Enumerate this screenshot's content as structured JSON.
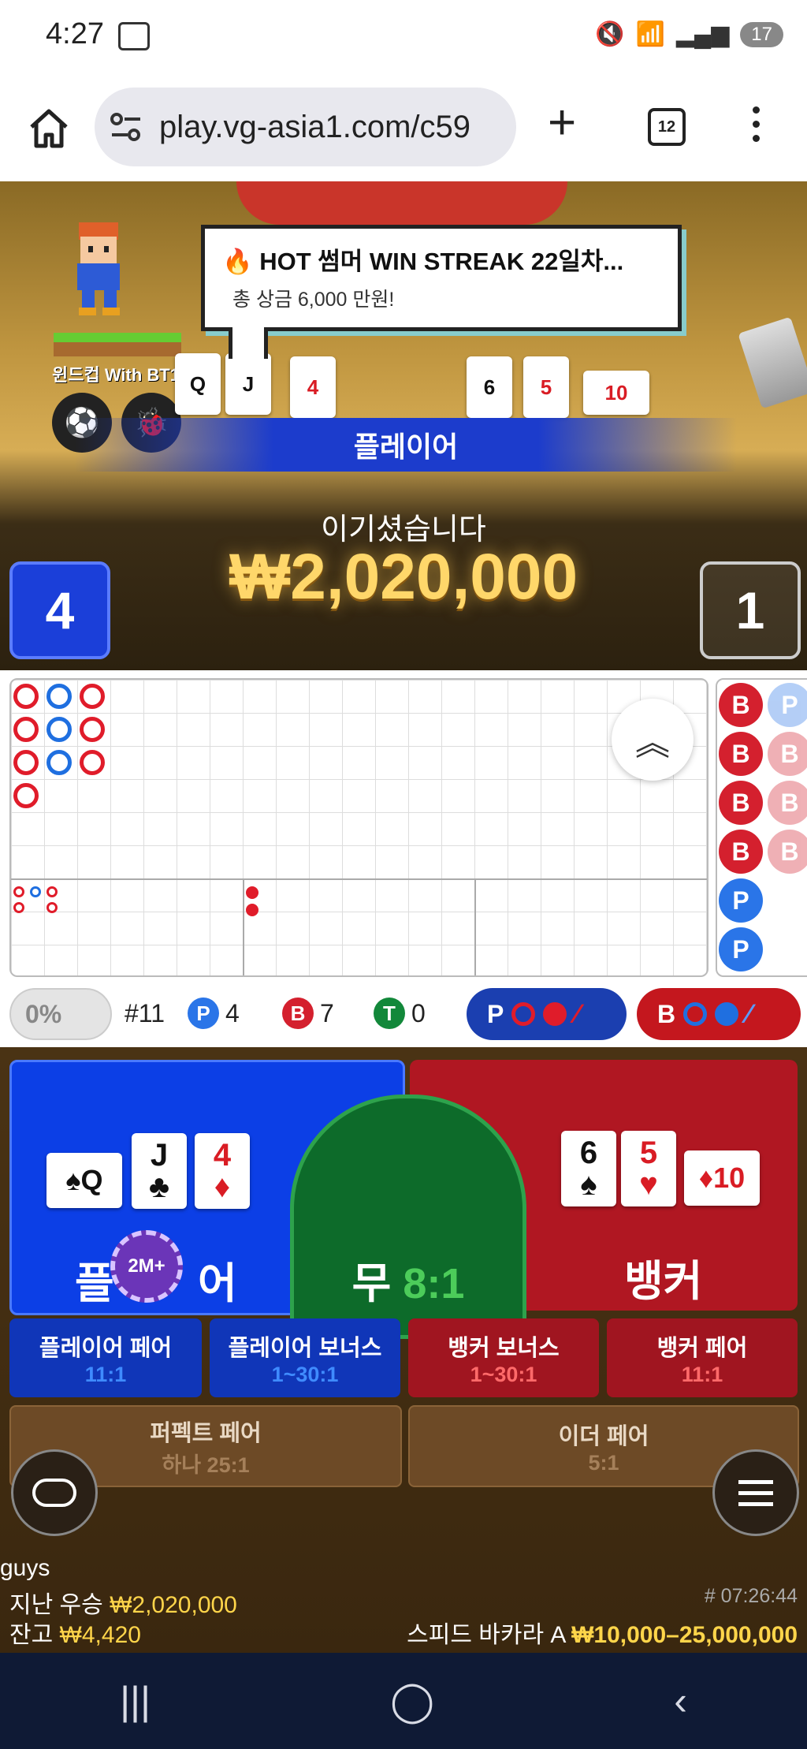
{
  "status": {
    "time": "4:27",
    "battery": "17"
  },
  "browser": {
    "url": "play.vg-asia1.com/c59",
    "tab_count": "12"
  },
  "video": {
    "avatar_name": "윈드컵 With BT1",
    "bubble_title": "🔥 HOT 썸머 WIN STREAK 22일차...",
    "bubble_sub": "총 상금 6,000 만원!",
    "player_bar": "플레이어",
    "win_label": "이기셨습니다",
    "win_amount": "₩2,020,000",
    "player_score": "4",
    "banker_score": "1",
    "table_cards": [
      "Q",
      "J",
      "4",
      "6",
      "5",
      "10"
    ]
  },
  "roadmap": {
    "bigroad_columns": [
      [
        "r",
        "r",
        "r",
        "r"
      ],
      [
        "b",
        "b",
        "b"
      ],
      [
        "r",
        "r",
        "r"
      ]
    ],
    "bead_col1": [
      "B",
      "B",
      "B",
      "B",
      "P",
      "P"
    ],
    "bead_col2": [
      "P",
      "B",
      "B",
      "B"
    ]
  },
  "stats": {
    "percent": "0%",
    "round": "#11",
    "p_label": "P",
    "p_count": "4",
    "b_label": "B",
    "b_count": "7",
    "t_label": "T",
    "t_count": "0",
    "p_ask": "P",
    "b_ask": "B"
  },
  "table": {
    "player_label": "플레이어",
    "player_label_a": "플",
    "player_label_b": "어",
    "banker_label": "뱅커",
    "tie_label": "무",
    "tie_odds": "8:1",
    "chip": "2M+",
    "player_cards": [
      {
        "rank": "Q",
        "suit": "♠",
        "color": "#111111"
      },
      {
        "rank": "J",
        "suit": "♣",
        "color": "#111111"
      },
      {
        "rank": "4",
        "suit": "♦",
        "color": "#d91c24"
      }
    ],
    "banker_cards": [
      {
        "rank": "6",
        "suit": "♠",
        "color": "#111111"
      },
      {
        "rank": "5",
        "suit": "♥",
        "color": "#d91c24"
      },
      {
        "rank": "10",
        "suit": "♦",
        "color": "#d91c24"
      }
    ],
    "side_bets": [
      {
        "title": "플레이어 페어",
        "odds": "11:1"
      },
      {
        "title": "플레이어 보너스",
        "odds": "1~30:1"
      },
      {
        "title": "뱅커 보너스",
        "odds": "1~30:1"
      },
      {
        "title": "뱅커 페어",
        "odds": "11:1"
      },
      {
        "title": "퍼펙트 페어",
        "odds": "하나 25:1"
      },
      {
        "title": "이더 페어",
        "odds": "5:1"
      }
    ]
  },
  "footer": {
    "user": "guys",
    "last_win_label": "지난 우승",
    "last_win_value": "₩2,020,000",
    "balance_label": "잔고",
    "balance_value": "₩4,420",
    "time": "# 07:26:44",
    "table_name": "스피드 바카라 A",
    "limits": "₩10,000–25,000,000"
  },
  "colors": {
    "player_blue": "#0c3fe6",
    "banker_red": "#b01722",
    "tie_green": "#0d6b2a",
    "gold": "#ffd54a"
  }
}
